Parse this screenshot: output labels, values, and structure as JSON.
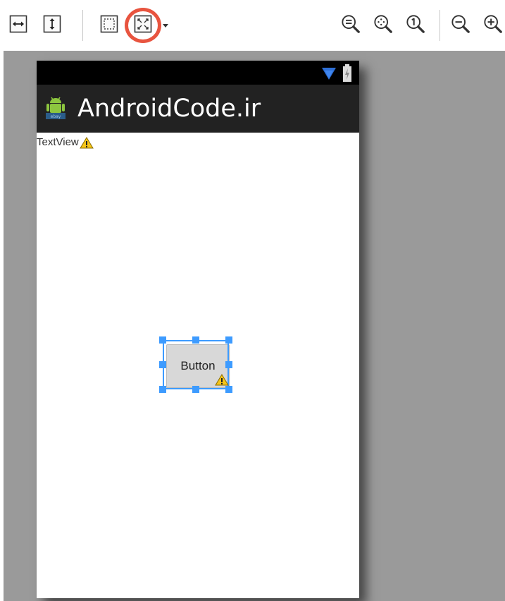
{
  "toolbar": {
    "buttons": [
      {
        "name": "fit-width-icon"
      },
      {
        "name": "fit-height-icon"
      },
      {
        "name": "layout-bounds-icon"
      },
      {
        "name": "emulate-real-size-icon",
        "highlighted": true
      },
      {
        "name": "zoom-fit-icon"
      },
      {
        "name": "zoom-to-fill-icon"
      },
      {
        "name": "zoom-actual-icon"
      },
      {
        "name": "zoom-out-icon"
      },
      {
        "name": "zoom-in-icon"
      }
    ],
    "highlight_color": "#e8543f"
  },
  "device": {
    "app_title": "AndroidCode.ir",
    "textview_label": "TextView",
    "button_label": "Button",
    "status_bar_color": "#000000",
    "action_bar_color": "#222222",
    "selection_color": "#3d9bff",
    "warning_color": "#f5c518"
  },
  "canvas_background": "#9a9a9a"
}
